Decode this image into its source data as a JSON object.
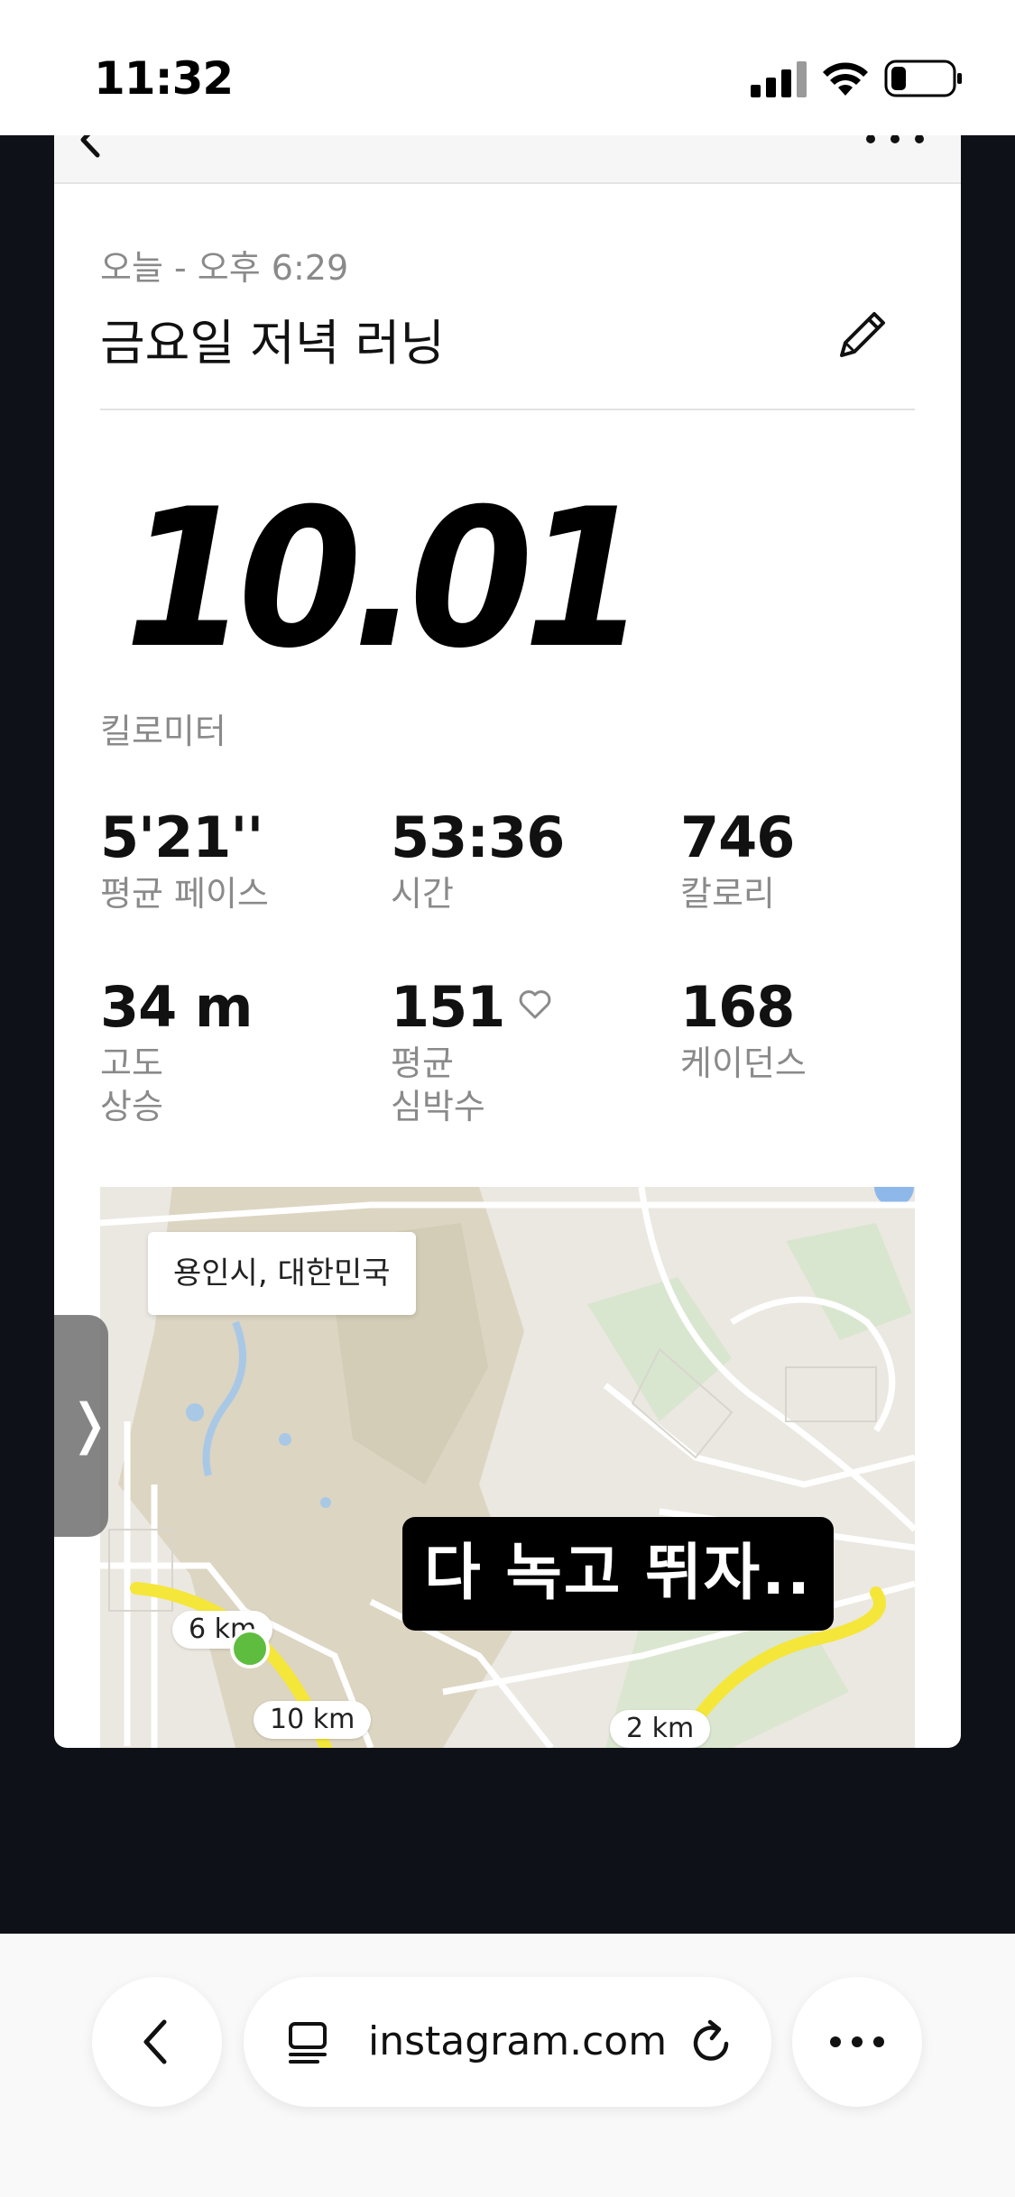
{
  "status_bar": {
    "time": "11:32"
  },
  "activity": {
    "date": "오늘 - 오후 6:29",
    "title": "금요일 저녁 러닝",
    "distance": "10.01",
    "distance_unit": "킬로미터",
    "stats": [
      {
        "value": "5'21''",
        "label": "평균 페이스"
      },
      {
        "value": "53:36",
        "label": "시간"
      },
      {
        "value": "746",
        "label": "칼로리"
      },
      {
        "value": "34 m",
        "label_line1": "고도",
        "label_line2": "상승"
      },
      {
        "value": "151",
        "label_line1": "평균",
        "label_line2": "심박수"
      },
      {
        "value": "168",
        "label": "케이던스"
      }
    ]
  },
  "map": {
    "location": "용인시, 대한민국",
    "km_markers": [
      "6 km",
      "10 km",
      "2 km"
    ]
  },
  "caption": "다 녹고 뛰자..",
  "side_handle": "❭",
  "browser": {
    "url": "instagram.com"
  },
  "colors": {
    "route": "#f5e63a",
    "start_marker": "#5ebd3e",
    "story_bg": "#0e1117"
  }
}
